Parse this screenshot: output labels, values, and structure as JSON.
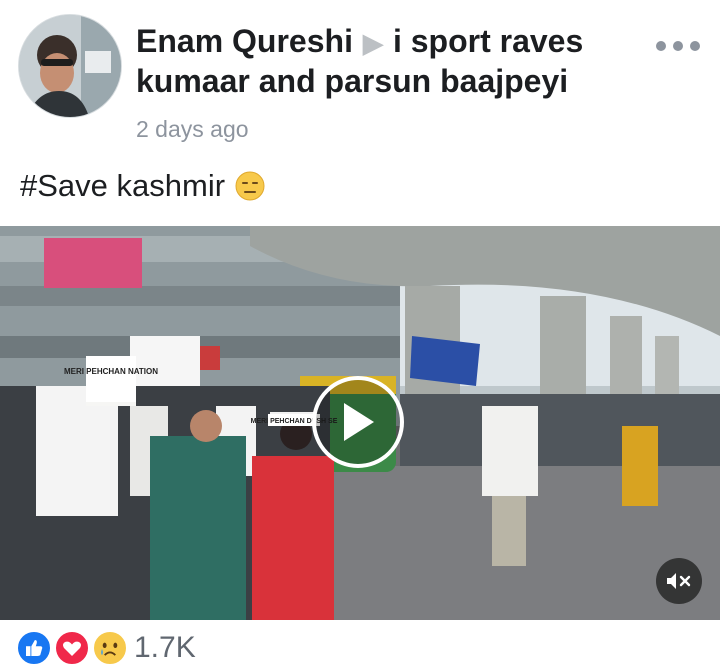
{
  "post": {
    "author": "Enam Qureshi",
    "target": "i sport raves kumaar and parsun baajpeyi",
    "time": "2 days ago",
    "text": "#Save kashmir"
  },
  "media": {
    "banners": [
      "MERI PEHCHAN NATION",
      "MERI PEHCHAN DESH SE"
    ]
  },
  "reactions": {
    "types": [
      "like-icon",
      "love-icon",
      "sad-icon"
    ],
    "count": "1.7K"
  },
  "colors": {
    "like": "#1877f2",
    "love": "#f0284a",
    "sad": "#f7c94b",
    "text": "#1c1e21",
    "muted": "#8d949e"
  }
}
